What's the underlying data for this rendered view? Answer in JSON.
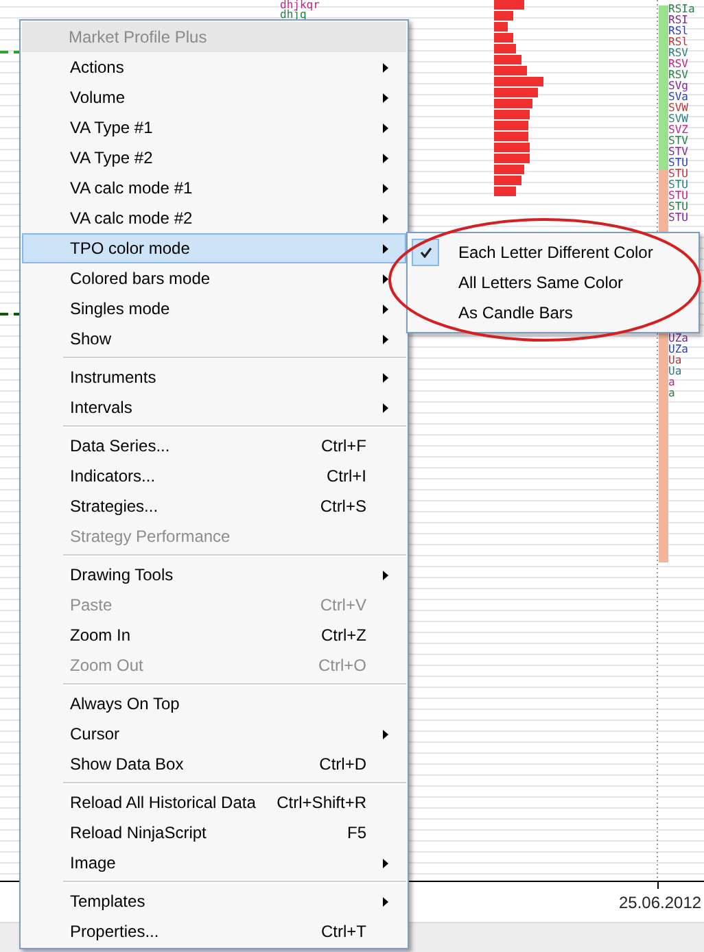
{
  "chart": {
    "date_label": "25.06.2012",
    "tpo_columns": [
      {
        "rows": [
          "dhjkqr",
          "dhjq"
        ]
      },
      {
        "rows": [
          "RSIa",
          "RSI",
          "RSl",
          "RSl",
          "RSV",
          "RSV",
          "RSV",
          "SVg",
          "SVa",
          "SVW",
          "SVW",
          "SVZ",
          "STV",
          "STV",
          "STU",
          "STU",
          "STU",
          "STU",
          "STU",
          "STU"
        ]
      },
      {
        "rows": [
          "UZa",
          "UZa",
          "Ua",
          "Ua",
          "a",
          "a"
        ]
      }
    ]
  },
  "menu": {
    "title": "Market Profile Plus",
    "groups": [
      [
        {
          "label": "Actions",
          "submenu": true,
          "selected": false,
          "disabled": false
        },
        {
          "label": "Volume",
          "submenu": true,
          "selected": false,
          "disabled": false
        },
        {
          "label": "VA Type #1",
          "submenu": true,
          "selected": false,
          "disabled": false
        },
        {
          "label": "VA Type #2",
          "submenu": true,
          "selected": false,
          "disabled": false
        },
        {
          "label": "VA calc mode #1",
          "submenu": true,
          "selected": false,
          "disabled": false
        },
        {
          "label": "VA calc mode #2",
          "submenu": true,
          "selected": false,
          "disabled": false
        },
        {
          "label": "TPO color mode",
          "submenu": true,
          "selected": true,
          "disabled": false
        },
        {
          "label": "Colored bars mode",
          "submenu": true,
          "selected": false,
          "disabled": false
        },
        {
          "label": "Singles mode",
          "submenu": true,
          "selected": false,
          "disabled": false
        },
        {
          "label": "Show",
          "submenu": true,
          "selected": false,
          "disabled": false
        }
      ],
      [
        {
          "label": "Instruments",
          "submenu": true,
          "selected": false,
          "disabled": false
        },
        {
          "label": "Intervals",
          "submenu": true,
          "selected": false,
          "disabled": false
        }
      ],
      [
        {
          "label": "Data Series...",
          "shortcut": "Ctrl+F",
          "submenu": false,
          "selected": false,
          "disabled": false
        },
        {
          "label": "Indicators...",
          "shortcut": "Ctrl+I",
          "submenu": false,
          "selected": false,
          "disabled": false
        },
        {
          "label": "Strategies...",
          "shortcut": "Ctrl+S",
          "submenu": false,
          "selected": false,
          "disabled": false
        },
        {
          "label": "Strategy Performance",
          "submenu": false,
          "selected": false,
          "disabled": true
        }
      ],
      [
        {
          "label": "Drawing Tools",
          "submenu": true,
          "selected": false,
          "disabled": false
        },
        {
          "label": "Paste",
          "shortcut": "Ctrl+V",
          "submenu": false,
          "selected": false,
          "disabled": true
        },
        {
          "label": "Zoom In",
          "shortcut": "Ctrl+Z",
          "submenu": false,
          "selected": false,
          "disabled": false
        },
        {
          "label": "Zoom Out",
          "shortcut": "Ctrl+O",
          "submenu": false,
          "selected": false,
          "disabled": true
        }
      ],
      [
        {
          "label": "Always On Top",
          "submenu": false,
          "selected": false,
          "disabled": false
        },
        {
          "label": "Cursor",
          "submenu": true,
          "selected": false,
          "disabled": false
        },
        {
          "label": "Show Data Box",
          "shortcut": "Ctrl+D",
          "submenu": false,
          "selected": false,
          "disabled": false
        }
      ],
      [
        {
          "label": "Reload All Historical Data",
          "shortcut": "Ctrl+Shift+R",
          "submenu": false,
          "selected": false,
          "disabled": false
        },
        {
          "label": "Reload NinjaScript",
          "shortcut": "F5",
          "submenu": false,
          "selected": false,
          "disabled": false
        },
        {
          "label": "Image",
          "submenu": true,
          "selected": false,
          "disabled": false
        }
      ],
      [
        {
          "label": "Templates",
          "submenu": true,
          "selected": false,
          "disabled": false
        },
        {
          "label": "Properties...",
          "shortcut": "Ctrl+T",
          "submenu": false,
          "selected": false,
          "disabled": false
        }
      ]
    ]
  },
  "submenu": {
    "items": [
      {
        "label": "Each Letter Different Color",
        "checked": true
      },
      {
        "label": "All Letters Same Color",
        "checked": false
      },
      {
        "label": "As Candle Bars",
        "checked": false
      }
    ]
  }
}
